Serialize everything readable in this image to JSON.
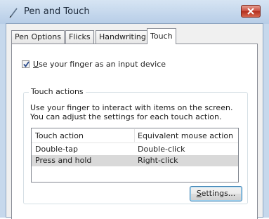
{
  "window": {
    "title": "Pen and Touch"
  },
  "tabs": [
    {
      "label": "Pen Options",
      "active": false
    },
    {
      "label": "Flicks",
      "active": false
    },
    {
      "label": "Handwriting",
      "active": false
    },
    {
      "label": "Touch",
      "active": true
    }
  ],
  "touch_input": {
    "checkbox_checked": true,
    "checkbox_label_mnemonic": "U",
    "checkbox_label_rest": "se your finger as an input device"
  },
  "touch_actions": {
    "group_label": "Touch actions",
    "description": "Use your finger to interact with items on the screen. You can adjust the settings for each touch action.",
    "columns": [
      "Touch action",
      "Equivalent mouse action"
    ],
    "rows": [
      {
        "action": "Double-tap",
        "mouse": "Double-click",
        "selected": false
      },
      {
        "action": "Press and hold",
        "mouse": "Right-click",
        "selected": true
      }
    ],
    "settings_button_mnemonic": "S",
    "settings_button_rest": "ettings..."
  },
  "icons": {
    "app": "pen-icon",
    "close": "close-icon",
    "check": "checkmark-icon"
  },
  "colors": {
    "close_button": "#c8483a",
    "selection": "#d9d9d9",
    "titlebar": "#c6d8ec"
  }
}
